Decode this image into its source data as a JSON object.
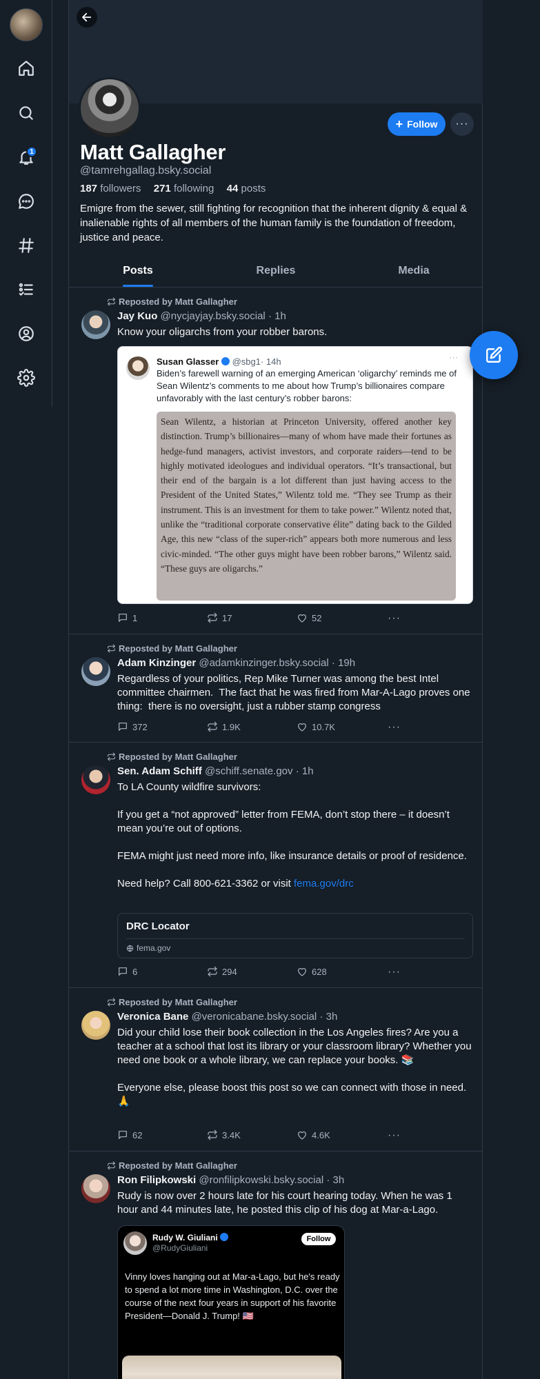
{
  "profile": {
    "display_name": "Matt Gallagher",
    "handle": "@tamrehgallag.bsky.social",
    "followers_count": "187",
    "followers_label": "followers",
    "following_count": "271",
    "following_label": "following",
    "posts_count": "44",
    "posts_label": "posts",
    "bio": "Emigre from the sewer, still fighting for recognition that the inherent dignity & equal & inalienable rights of all members of the human family is the foundation of freedom, justice and peace.",
    "follow_label": "Follow",
    "more_label": "···"
  },
  "nav": {
    "notification_count": "1",
    "items": [
      {
        "icon": "home-icon"
      },
      {
        "icon": "search-icon"
      },
      {
        "icon": "bell-icon"
      },
      {
        "icon": "chat-icon"
      },
      {
        "icon": "hashtag-icon"
      },
      {
        "icon": "list-icon"
      },
      {
        "icon": "profile-icon"
      },
      {
        "icon": "gear-icon"
      }
    ]
  },
  "tabs": [
    {
      "label": "Posts",
      "active": true
    },
    {
      "label": "Replies",
      "active": false
    },
    {
      "label": "Media",
      "active": false
    }
  ],
  "posts": [
    {
      "reposted_by": "Reposted by Matt Gallagher",
      "author_name": "Jay Kuo",
      "author_handle": "@nycjayjay.bsky.social",
      "time": "· 1h",
      "text": "Know your oligarchs from your robber barons.",
      "quote": {
        "author_name": "Susan Glasser",
        "author_handle": "@sbg1",
        "time": "· 14h",
        "text": "Biden’s farewell warning of an emerging American ‘oligarchy’ reminds me of Sean Wilentz’s comments to me about how Trump’s billionaires compare unfavorably with the last century’s robber barons:",
        "image_text": "Sean Wilentz, a historian at Princeton University, offered another key distinction. Trump’s billionaires—many of whom have made their fortunes as hedge-fund managers, activist investors, and corporate raiders—tend to be highly motivated ideologues and individual operators. “It’s transactional, but their end of the bargain is a lot different than just having access to the President of the United States,” Wilentz told me. “They see Trump as their instrument. This is an investment for them to take power.” Wilentz noted that, unlike the “traditional corporate conservative élite” dating back to the Gilded Age, this new “class of the super-rich” appears both more numerous and less civic-minded. “The other guys might have been robber barons,” Wilentz said. “These guys are oligarchs.”"
      },
      "replies": "1",
      "reposts": "17",
      "likes": "52"
    },
    {
      "reposted_by": "Reposted by Matt Gallagher",
      "author_name": "Adam Kinzinger",
      "author_handle": "@adamkinzinger.bsky.social",
      "time": "· 19h",
      "text": "Regardless of your politics, Rep Mike Turner was among the best Intel committee chairmen.  The fact that he was fired from Mar-A-Lago proves one thing:  there is no oversight, just a rubber stamp congress",
      "replies": "372",
      "reposts": "1.9K",
      "likes": "10.7K"
    },
    {
      "reposted_by": "Reposted by Matt Gallagher",
      "author_name": "Sen. Adam Schiff",
      "author_handle": "@schiff.senate.gov",
      "time": "· 1h",
      "text": "To LA County wildfire survivors:\n\nIf you get a “not approved” letter from FEMA, don’t stop there – it doesn’t mean you’re out of options.\n\nFEMA might just need more info, like insurance details or proof of residence.\n\nNeed help? Call 800-621-3362 or visit ",
      "link_text": "fema.gov/drc",
      "link_card": {
        "title": "DRC Locator",
        "domain": "fema.gov"
      },
      "replies": "6",
      "reposts": "294",
      "likes": "628"
    },
    {
      "reposted_by": "Reposted by Matt Gallagher",
      "author_name": "Veronica Bane",
      "author_handle": "@veronicabane.bsky.social",
      "time": "· 3h",
      "text": "Did your child lose their book collection in the Los Angeles fires? Are you a teacher at a school that lost its library or your classroom library? Whether you need one book or a whole library, we can replace your books. 📚\n\nEveryone else, please boost this post so we can connect with those in need. 🙏",
      "replies": "62",
      "reposts": "3.4K",
      "likes": "4.6K"
    },
    {
      "reposted_by": "Reposted by Matt Gallagher",
      "author_name": "Ron Filipkowski",
      "author_handle": "@ronfilipkowski.bsky.social",
      "time": "· 3h",
      "text": "Rudy is now over 2 hours late for his court hearing today. When he was 1 hour and 44 minutes late, he posted this clip of his dog at Mar-a-Lago.",
      "embedded": {
        "author_name": "Rudy W. Giuliani",
        "author_handle": "@RudyGiuliani",
        "follow_label": "Follow",
        "text": "Vinny loves hanging out at Mar-a-Lago, but he's ready to spend a lot more time in Washington, D.C. over the course of the next four years in support of his favorite President—Donald J. Trump! 🇺🇸"
      }
    }
  ],
  "colors": {
    "background": "#161e27",
    "accent": "#1d7cf2",
    "muted_text": "#a9b4c2",
    "divider": "#2e3b4a"
  }
}
